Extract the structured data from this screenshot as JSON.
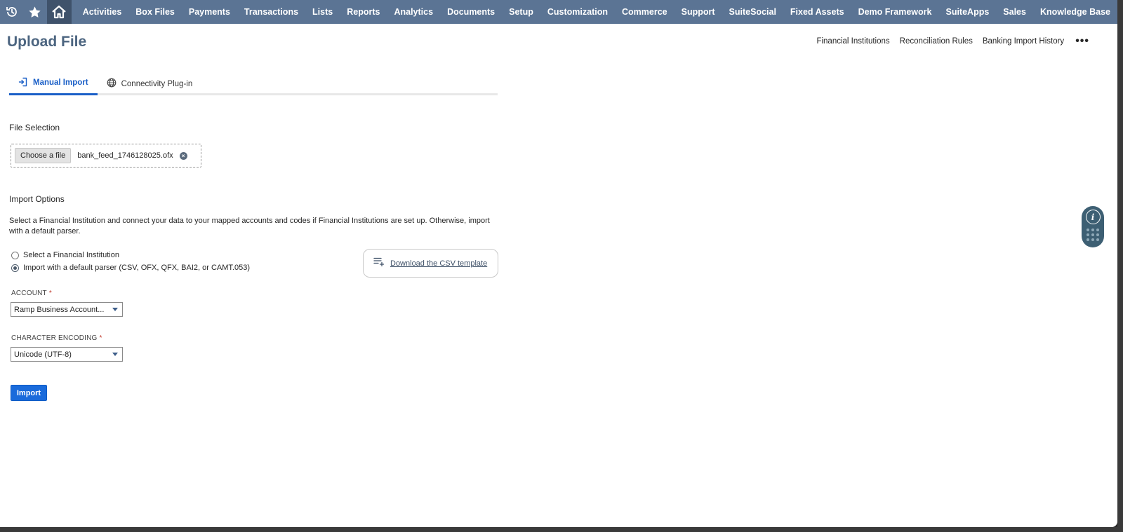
{
  "nav": {
    "icons": [
      "history-icon",
      "star-icon",
      "home-icon"
    ],
    "items": [
      "Activities",
      "Box Files",
      "Payments",
      "Transactions",
      "Lists",
      "Reports",
      "Analytics",
      "Documents",
      "Setup",
      "Customization",
      "Commerce",
      "Support",
      "SuiteSocial",
      "Fixed Assets",
      "Demo Framework",
      "SuiteApps",
      "Sales",
      "Knowledge Base"
    ]
  },
  "header": {
    "title": "Upload File",
    "links": [
      "Financial Institutions",
      "Reconciliation Rules",
      "Banking Import History"
    ],
    "more_label": "•••"
  },
  "tabs": [
    {
      "label": "Manual Import",
      "icon": "import-icon",
      "active": true
    },
    {
      "label": "Connectivity Plug-in",
      "icon": "globe-icon",
      "active": false
    }
  ],
  "file_selection": {
    "label": "File Selection",
    "choose_label": "Choose a file",
    "file_name": "bank_feed_1746128025.ofx",
    "remove_symbol": "×"
  },
  "import_options": {
    "label": "Import Options",
    "description": "Select a Financial Institution and connect your data to your mapped accounts and codes if Financial Institutions are set up. Otherwise, import with a default parser.",
    "radios": [
      {
        "label": "Select a Financial Institution",
        "checked": false
      },
      {
        "label": "Import with a default parser (CSV, OFX, QFX, BAI2, or CAMT.053)",
        "checked": true
      }
    ],
    "csv_template_label": "Download the CSV template"
  },
  "account": {
    "label": "ACCOUNT",
    "required": "*",
    "value": "Ramp Business Account..."
  },
  "encoding": {
    "label": "CHARACTER ENCODING",
    "required": "*",
    "value": "Unicode (UTF-8)"
  },
  "import_button": "Import",
  "help_widget": {
    "info_symbol": "i"
  },
  "colors": {
    "nav_bg": "#5b7494",
    "home_bg": "#3f526b",
    "title": "#4c6580",
    "accent": "#1a5fc7",
    "import_button": "#1a6bdb",
    "help_widget": "#3d5f73"
  }
}
